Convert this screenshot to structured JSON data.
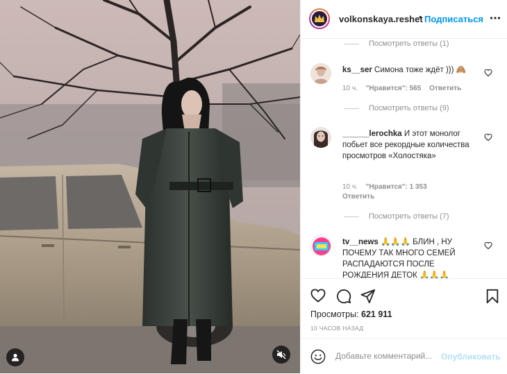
{
  "post": {
    "username": "volkonskaya.reshet",
    "separator": "•",
    "follow_label": "Подписаться",
    "more_icon": "more-horizontal-icon"
  },
  "comments": {
    "top_view_replies": "Посмотреть ответы (1)",
    "items": [
      {
        "username": "ks__ser",
        "text": " Симона тоже ждёт ))) 🙈",
        "time": "10 ч.",
        "likes": "\"Нравится\": 565",
        "reply_label": "Ответить",
        "view_replies": "Посмотреть ответы (9)"
      },
      {
        "username": "______lerochka",
        "text": " И этот монолог побьет все рекордные количества просмотров «Холостяка»",
        "time": "10 ч.",
        "likes": "\"Нравится\": 1 353",
        "reply_label": "Ответить",
        "view_replies": "Посмотреть ответы (7)"
      },
      {
        "username": "tv__news",
        "text": " 🙏🙏🙏 БЛИН , НУ ПОЧЕМУ ТАК МНОГО СЕМЕЙ РАСПАДАЮТСЯ ПОСЛЕ РОЖДЕНИЯ ДЕТОК 🙏🙏🙏"
      }
    ]
  },
  "stats": {
    "views_label": "Просмотры:",
    "views_value": "621 911",
    "posted": "10 ЧАСОВ НАЗАД"
  },
  "composer": {
    "placeholder": "Добавьте комментарий...",
    "publish_label": "Опубликовать"
  },
  "colors": {
    "link_blue": "#0095f6",
    "publish_disabled": "#b2dffc",
    "muted_text": "#8e8e8e"
  }
}
